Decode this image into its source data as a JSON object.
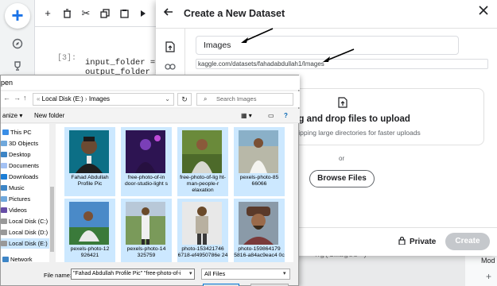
{
  "notebook": {
    "prompt": "[3]:",
    "code_lines": [
      "input_folder = '/",
      "output_folder = '"
    ],
    "bg_code_fragment": "ng(Images\")",
    "bg_right_label": "Mod"
  },
  "kaggle": {
    "title": "Create a New Dataset",
    "dataset_title_value": "Images",
    "dataset_url": "kaggle.com/datasets/fahadabdullah1/Images",
    "drop_heading": "ag and drop files to upload",
    "drop_subtext": "zipping large directories for faster uploads",
    "or_text": "or",
    "browse_label": "Browse Files",
    "privacy_label": "Private",
    "create_label": "Create"
  },
  "open_dialog": {
    "title_fragment": "pen",
    "breadcrumb": [
      "Local Disk (E:)",
      "Images"
    ],
    "search_placeholder": "Search Images",
    "organize_label": "anize",
    "new_folder_label": "New folder",
    "nav_items": [
      "This PC",
      "3D Objects",
      "Desktop",
      "Documents",
      "Downloads",
      "Music",
      "Pictures",
      "Videos",
      "Local Disk (C:)",
      "Local Disk (D:)",
      "Local Disk (E:)",
      "Network"
    ],
    "files": [
      {
        "name": "Fahad Abdullah Profile Pic"
      },
      {
        "name": "free-photo-of-in door-studio-light s"
      },
      {
        "name": "free-photo-of-lig ht-man-people-r elaxation"
      },
      {
        "name": "pexels-photo-85 66066"
      },
      {
        "name": "pexels-photo-12 926421"
      },
      {
        "name": "pexels-photo-14 325759"
      },
      {
        "name": "photo-153421746 6718-ef4950786e 24"
      },
      {
        "name": "photo-159864179 5816-a84ac9eac4 0c"
      }
    ],
    "file_name_label": "File name:",
    "file_name_value": "\"Fahad Abdullah Profile Pic\" \"free-photo-of-i",
    "file_type_value": "All Files"
  },
  "colors": {
    "kaggle_blue": "#1a73e8",
    "selection_blue": "#cce8ff",
    "create_disabled": "#c5c8cc"
  }
}
